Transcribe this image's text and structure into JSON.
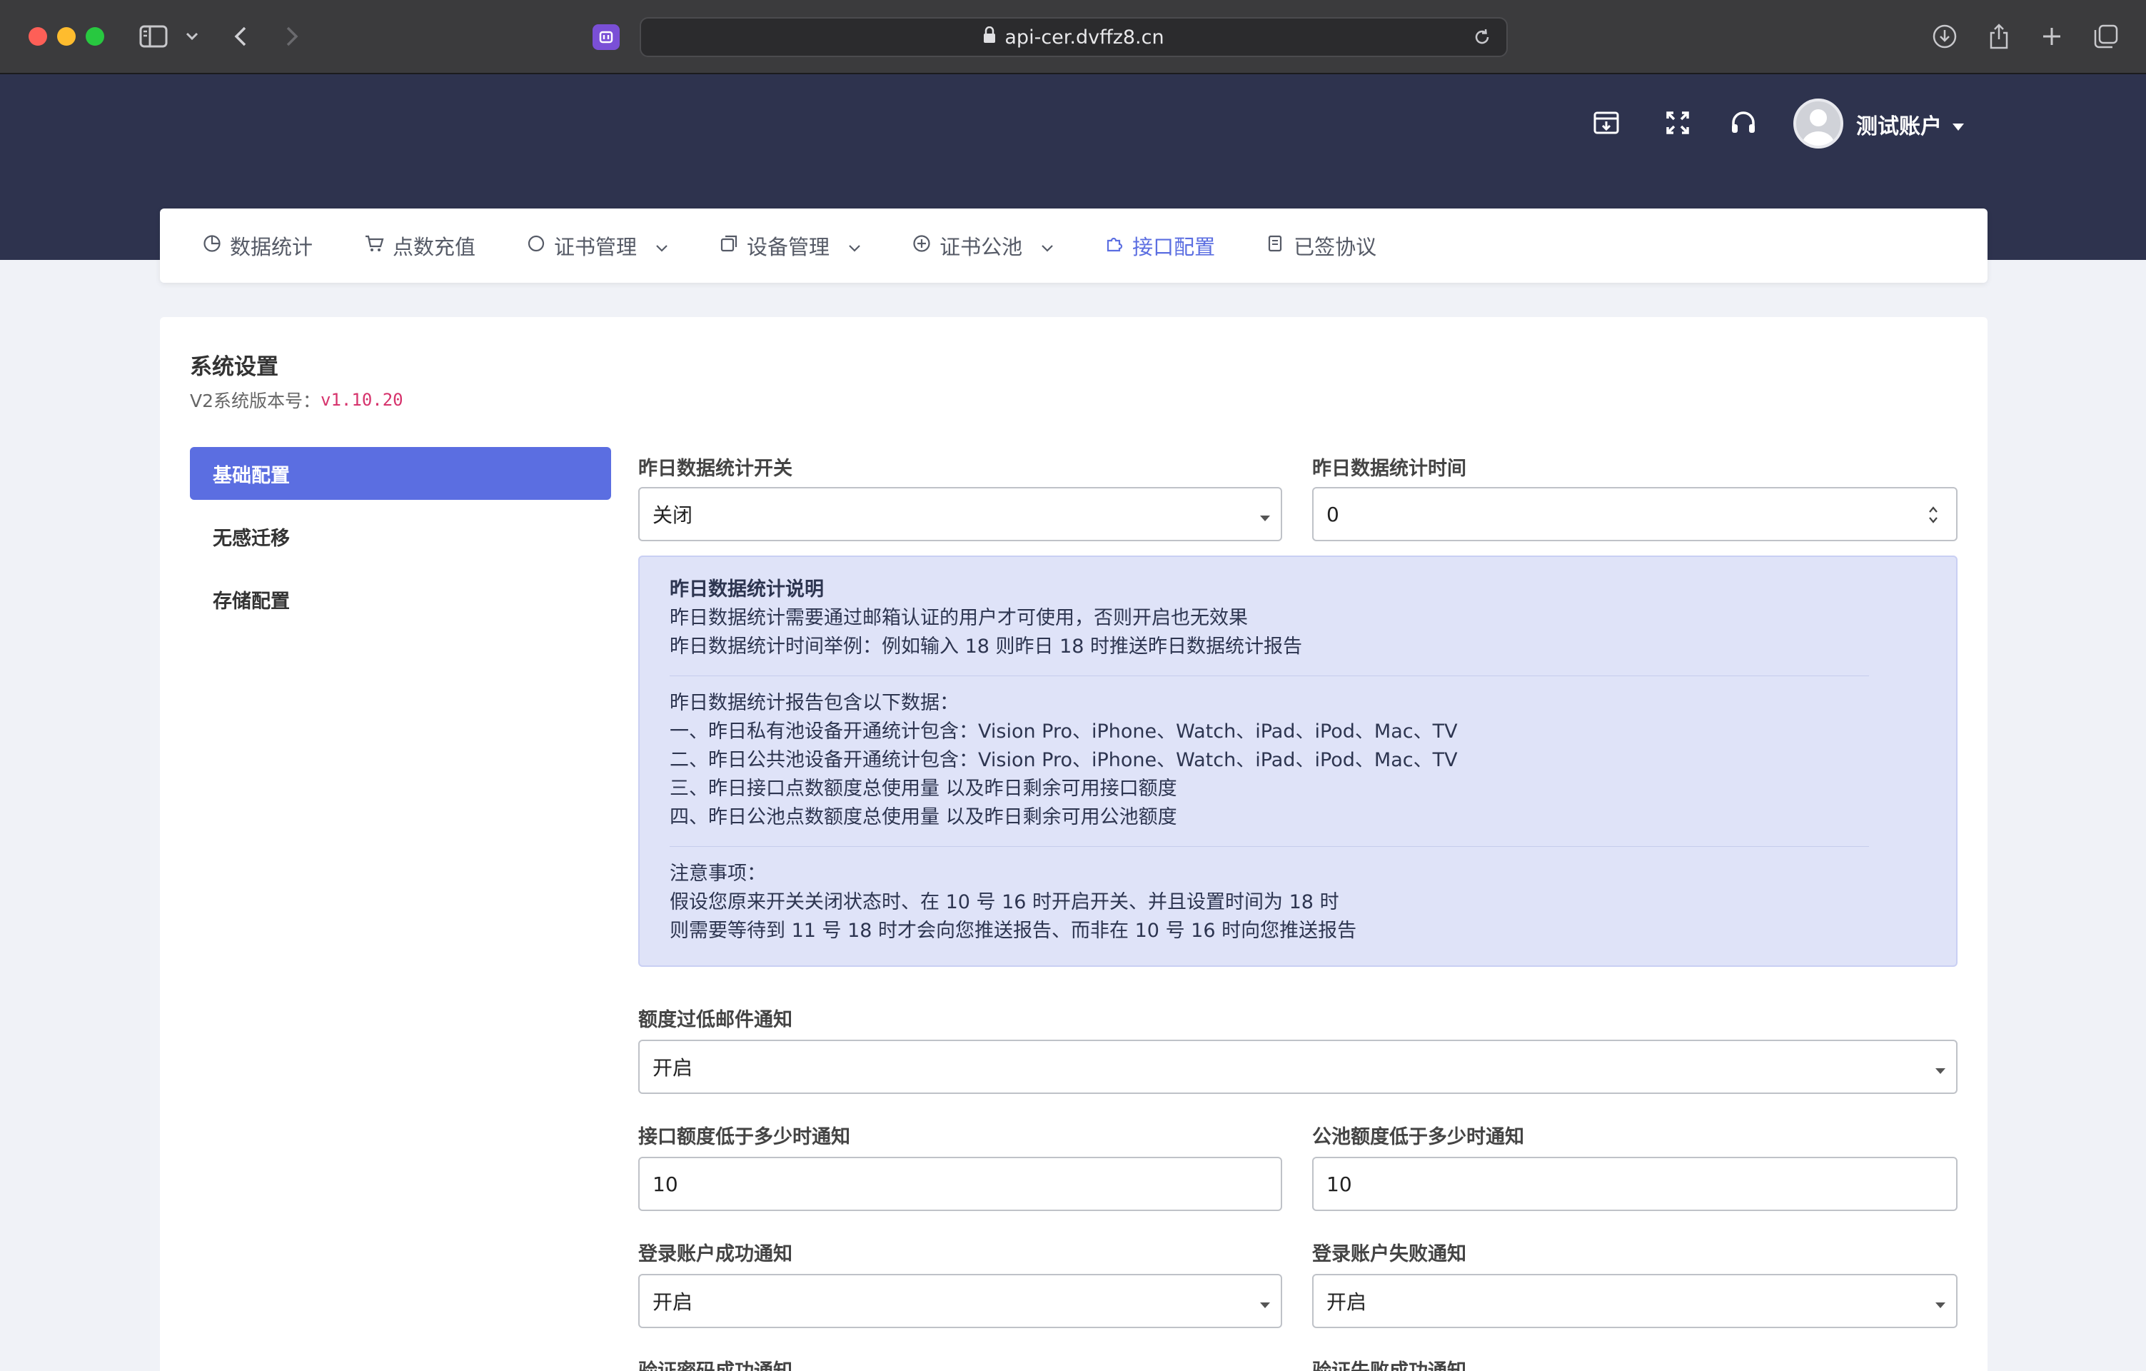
{
  "browser": {
    "url": "api-cer.dvffz8.cn"
  },
  "header": {
    "account_name": "测试账户"
  },
  "nav": {
    "items": [
      {
        "label": "数据统计",
        "has_dropdown": false,
        "active": false
      },
      {
        "label": "点数充值",
        "has_dropdown": false,
        "active": false
      },
      {
        "label": "证书管理",
        "has_dropdown": true,
        "active": false
      },
      {
        "label": "设备管理",
        "has_dropdown": true,
        "active": false
      },
      {
        "label": "证书公池",
        "has_dropdown": true,
        "active": false
      },
      {
        "label": "接口配置",
        "has_dropdown": false,
        "active": true
      },
      {
        "label": "已签协议",
        "has_dropdown": false,
        "active": false
      }
    ]
  },
  "page": {
    "title": "系统设置",
    "version_label": "V2系统版本号：",
    "version_value": "v1.10.20"
  },
  "side_menu": {
    "items": [
      {
        "label": "基础配置",
        "active": true
      },
      {
        "label": "无感迁移",
        "active": false
      },
      {
        "label": "存储配置",
        "active": false
      }
    ]
  },
  "form": {
    "stats_switch": {
      "label": "昨日数据统计开关",
      "value": "关闭"
    },
    "stats_time": {
      "label": "昨日数据统计时间",
      "value": "0"
    },
    "info": {
      "title": "昨日数据统计说明",
      "lines_1": [
        "昨日数据统计需要通过邮箱认证的用户才可使用，否则开启也无效果",
        "昨日数据统计时间举例：例如输入 18 则昨日 18 时推送昨日数据统计报告"
      ],
      "lines_2": [
        "昨日数据统计报告包含以下数据：",
        "一、昨日私有池设备开通统计包含：Vision Pro、iPhone、Watch、iPad、iPod、Mac、TV",
        "二、昨日公共池设备开通统计包含：Vision Pro、iPhone、Watch、iPad、iPod、Mac、TV",
        "三、昨日接口点数额度总使用量 以及昨日剩余可用接口额度",
        "四、昨日公池点数额度总使用量 以及昨日剩余可用公池额度"
      ],
      "lines_3": [
        "注意事项：",
        "假设您原来开关关闭状态时、在 10 号 16 时开启开关、并且设置时间为 18 时",
        "则需要等待到 11 号 18 时才会向您推送报告、而非在 10 号 16 时向您推送报告"
      ]
    },
    "low_quota_email": {
      "label": "额度过低邮件通知",
      "value": "开启"
    },
    "api_quota_threshold": {
      "label": "接口额度低于多少时通知",
      "value": "10"
    },
    "pool_quota_threshold": {
      "label": "公池额度低于多少时通知",
      "value": "10"
    },
    "login_success": {
      "label": "登录账户成功通知",
      "value": "开启"
    },
    "login_fail": {
      "label": "登录账户失败通知",
      "value": "开启"
    },
    "verify_pwd_success": {
      "label": "验证密码成功通知"
    },
    "verify_fail_success": {
      "label": "验证失败成功通知"
    }
  }
}
